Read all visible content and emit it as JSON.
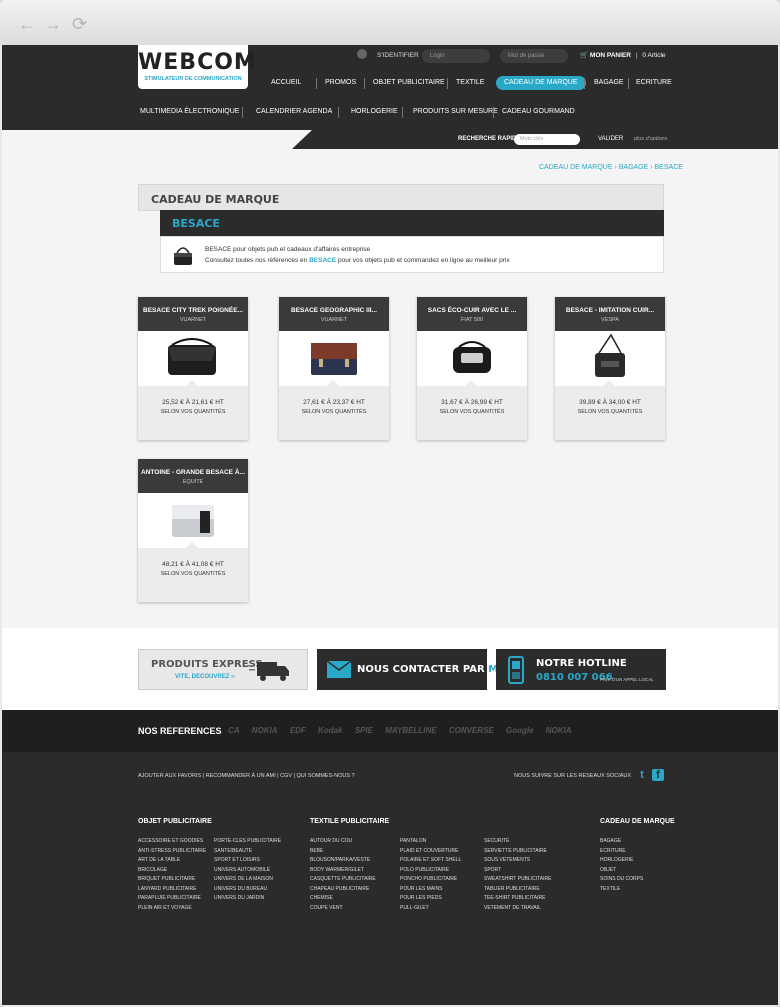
{
  "brand": {
    "name": "WEBCOM",
    "tagline": "STIMULATEUR DE COMMUNICATION"
  },
  "account": {
    "identify_label": "S'IDENTIFIER",
    "login_placeholder": "Login",
    "password_placeholder": "Mot de passe",
    "cart_label": "MON PANIER",
    "cart_count": "0 Article"
  },
  "menu_primary": [
    "ACCUEIL",
    "PROMOS",
    "OBJET PUBLICITAIRE",
    "TEXTILE",
    "CADEAU DE MARQUE",
    "BAGAGE",
    "ECRITURE"
  ],
  "menu_secondary": [
    "MULTIMEDIA ÉLECTRONIQUE",
    "CALENDRIER AGENDA",
    "HORLOGERIE",
    "PRODUITS SUR MESURE",
    "CADEAU GOURMAND"
  ],
  "search": {
    "label": "RECHERCHE RAPIDE",
    "placeholder": "Mots clés",
    "button": "VALIDER",
    "more": "plus d'options"
  },
  "breadcrumb": "CADEAU DE MARQUE › BAGAGE › BESACE",
  "category": {
    "title": "CADEAU DE MARQUE",
    "subtitle": "BESACE",
    "line1": "BESACE pour objets pub et cadeaux d'affaires entreprise",
    "line2_pre": "Consultez toutes nos références en",
    "line2_key": "BESACE",
    "line2_post": "pour vos objets pub et commandez en ligne au meilleur prix"
  },
  "products": [
    {
      "name": "BESACE CITY TREK POIGNÉE...",
      "brand": "VUARNET",
      "price": "25,52 € À 21,61 € HT",
      "qty": "SELON VOS QUANTITÉS"
    },
    {
      "name": "BESACE GEOGRAPHIC III...",
      "brand": "VUARNET",
      "price": "27,61 € À 23,37 € HT",
      "qty": "SELON VOS QUANTITÉS"
    },
    {
      "name": "SACS ÉCO-CUIR AVEC LE ...",
      "brand": "FIAT 500",
      "price": "31,67 € À 26,99 € HT",
      "qty": "SELON VOS QUANTITÉS"
    },
    {
      "name": "BESACE - IMITATION CUIR...",
      "brand": "VESPA",
      "price": "39,89 € À 34,00 € HT",
      "qty": "SELON VOS QUANTITÉS"
    },
    {
      "name": "ANTOINE - GRANDE BESACE À...",
      "brand": "EQUITE",
      "price": "48,21 € À 41,08 € HT",
      "qty": "SELON VOS QUANTITÉS"
    }
  ],
  "banners": {
    "express_title": "PRODUITS EXPRESS",
    "express_sub": "VITE, DECOUVREZ ››",
    "contact_pre": "NOUS CONTACTER PAR",
    "contact_key": "MAIL",
    "hotline_title": "NOTRE HOTLINE",
    "hotline_number": "0810 007 066",
    "hotline_note": "PRIX D'UN APPEL LOCAL"
  },
  "references": {
    "title": "NOS REFERENCES",
    "brands": [
      "CA",
      "NOKIA",
      "EDF",
      "Kodak",
      "SPIE",
      "MAYBELLINE",
      "CONVERSE",
      "Google",
      "NOKIA"
    ]
  },
  "footer": {
    "links": "AJOUTER AUX FAVORIS | RECOMMANDER À UN AMI | CGV | QUI SOMMES-NOUS ?",
    "social": "NOUS SUIVRE SUR LES RESEAUX SOCIAUX",
    "col1_title": "OBJET PUBLICITAIRE",
    "col1a": [
      "ACCESSOIRE ET GOODIES",
      "ANTI-STRESS PUBLICITAIRE",
      "ART DE LA TABLE",
      "BRICOLAGE",
      "BRIQUET PUBLICITAIRE",
      "LANYARD PUBLICITAIRE",
      "PARAPLUIE PUBLICITAIRE",
      "PLEIN AIR ET VOYAGE"
    ],
    "col1b": [
      "PORTE-CLES PUBLICITAIRE",
      "SANTE/BEAUTE",
      "SPORT ET LOISIRS",
      "UNIVERS AUTOMOBILE",
      "UNIVERS DE LA MAISON",
      "UNIVERS DU BUREAU",
      "UNIVERS DU JARDIN"
    ],
    "col2_title": "TEXTILE PUBLICITAIRE",
    "col2a": [
      "AUTOUR DU COU",
      "BEBE",
      "BLOUSON/PARKA/VESTE",
      "BODY WARMER/GILET",
      "CASQUETTE PUBLICITAIRE",
      "CHAPEAU PUBLICITAIRE",
      "CHEMISE",
      "COUPE VENT"
    ],
    "col2b": [
      "PANTALON",
      "PLAID ET COUVERTURE",
      "POLAIRE ET SOFT SHELL",
      "POLO PUBLICITAIRE",
      "PONCHO PUBLICITAIRE",
      "POUR LES MAINS",
      "POUR LES PIEDS",
      "PULL-GILET"
    ],
    "col2c": [
      "SECURITE",
      "SERVIETTE PUBLICITAIRE",
      "SOUS VETEMENTS",
      "SPORT",
      "SWEATSHIRT PUBLICITAIRE",
      "TABLIER PUBLICITAIRE",
      "TEE-SHIRT PUBLICITAIRE",
      "VETEMENT DE TRAVAIL"
    ],
    "col3_title": "CADEAU DE MARQUE",
    "col3": [
      "BAGAGE",
      "ECRITURE",
      "HORLOGERIE",
      "OBJET",
      "SOINS DU CORPS",
      "TEXTILE"
    ]
  },
  "colors": {
    "accent": "#2aa8c8",
    "dark": "#2b2b2b"
  }
}
